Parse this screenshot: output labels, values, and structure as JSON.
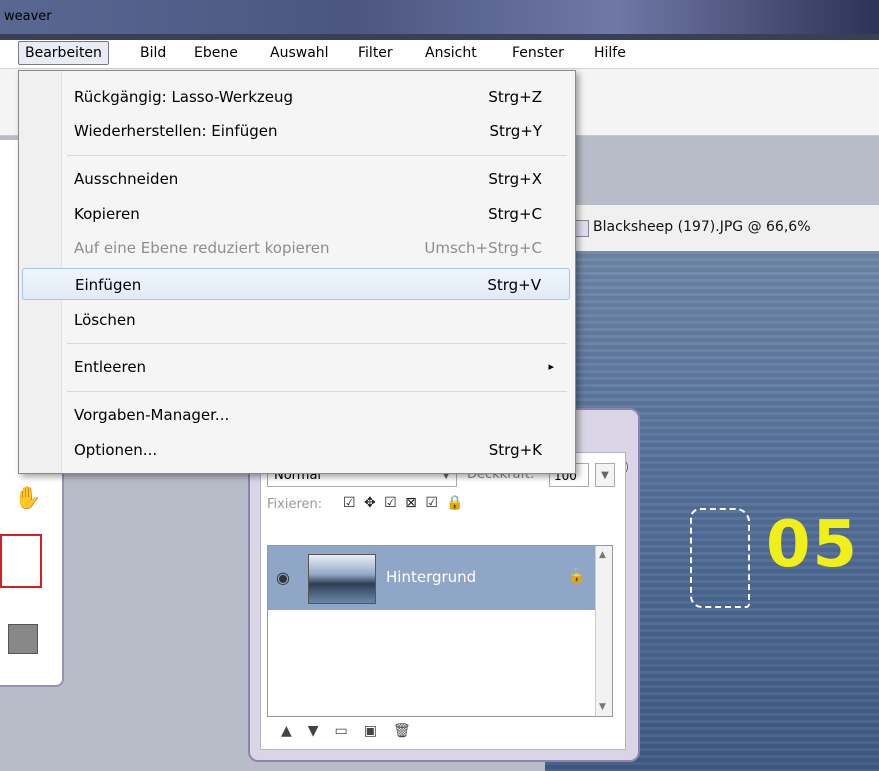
{
  "window": {
    "title": "weaver"
  },
  "menubar": {
    "items": [
      "Bearbeiten",
      "Bild",
      "Ebene",
      "Auswahl",
      "Filter",
      "Ansicht",
      "Fenster",
      "Hilfe"
    ]
  },
  "edit_menu": {
    "undo": {
      "label": "Rückgängig: Lasso-Werkzeug",
      "shortcut": "Strg+Z"
    },
    "redo": {
      "label": "Wiederherstellen: Einfügen",
      "shortcut": "Strg+Y"
    },
    "cut": {
      "label": "Ausschneiden",
      "shortcut": "Strg+X"
    },
    "copy": {
      "label": "Kopieren",
      "shortcut": "Strg+C"
    },
    "copy_merged": {
      "label": "Auf eine Ebene reduziert kopieren",
      "shortcut": "Umsch+Strg+C"
    },
    "paste": {
      "label": "Einfügen",
      "shortcut": "Strg+V"
    },
    "delete": {
      "label": "Löschen"
    },
    "purge": {
      "label": "Entleeren"
    },
    "preset_manager": {
      "label": "Vorgaben-Manager..."
    },
    "options": {
      "label": "Optionen...",
      "shortcut": "Strg+K"
    }
  },
  "document": {
    "title": "Blacksheep (197).JPG @ 66,6%",
    "overlay_text": "05"
  },
  "layers_panel": {
    "blend_mode": "Normal",
    "opacity_label": "Deckkraft:",
    "opacity_value": "100",
    "lock_label": "Fixieren:",
    "layer_name": "Hintergrund"
  },
  "icons": {
    "submenu_arrow": "▸",
    "eye": "👁",
    "lock": "🔒",
    "hand_tool": "✋",
    "layer_lock": "🔒"
  }
}
